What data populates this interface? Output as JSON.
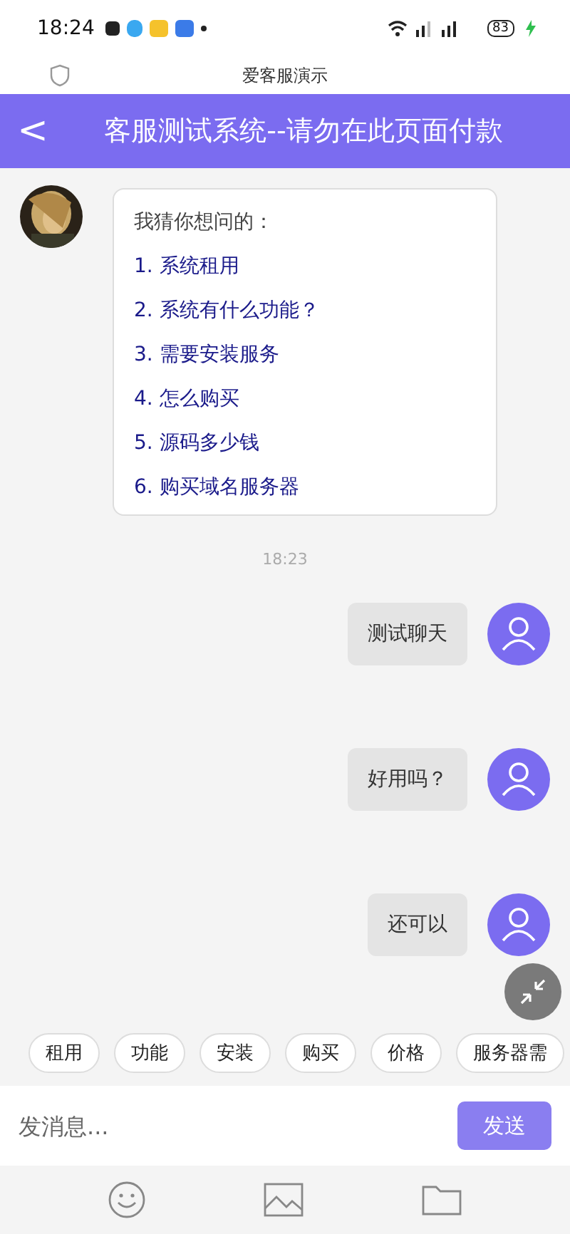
{
  "status_bar": {
    "time": "18:24",
    "battery": "83"
  },
  "browser": {
    "title": "爱客服演示"
  },
  "header": {
    "back": "<",
    "title": "客服测试系统--请勿在此页面付款"
  },
  "messages": [
    {
      "kind": "menu",
      "title": "我猜你想问的：",
      "items": [
        {
          "number": "1.",
          "label": "系统租用"
        },
        {
          "number": "2.",
          "label": "系统有什么功能？"
        },
        {
          "number": "3.",
          "label": "需要安装服务"
        },
        {
          "number": "4.",
          "label": "怎么购买"
        },
        {
          "number": "5.",
          "label": "源码多少钱"
        },
        {
          "number": "6.",
          "label": "购买域名服务器"
        }
      ]
    },
    {
      "kind": "time",
      "text": "18:23"
    },
    {
      "kind": "user_text",
      "text": "测试聊天"
    },
    {
      "kind": "user_text",
      "text": "好用吗？"
    },
    {
      "kind": "user_text",
      "text": "还可以"
    }
  ],
  "quick_replies": [
    "租用",
    "功能",
    "安装",
    "购买",
    "价格",
    "服务器需"
  ],
  "composer": {
    "placeholder": "发消息...",
    "send": "发送"
  }
}
